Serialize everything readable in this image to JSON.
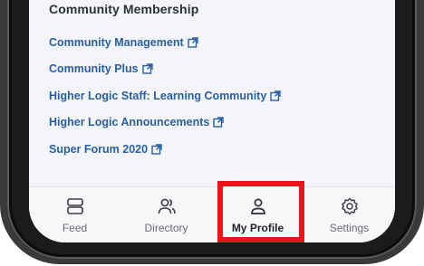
{
  "section": {
    "title": "Community Membership"
  },
  "links": [
    {
      "label": "Community Management",
      "icon": "external-link-icon"
    },
    {
      "label": "Community Plus",
      "icon": "external-link-icon"
    },
    {
      "label": "Higher Logic Staff: Learning Community",
      "icon": "external-link-icon"
    },
    {
      "label": "Higher Logic Announcements",
      "icon": "external-link-icon"
    },
    {
      "label": "Super Forum 2020",
      "icon": "external-link-icon"
    }
  ],
  "tabbar": {
    "tabs": [
      {
        "label": "Feed",
        "icon": "feed-icon"
      },
      {
        "label": "Directory",
        "icon": "directory-icon"
      },
      {
        "label": "My Profile",
        "icon": "profile-icon",
        "active": true
      },
      {
        "label": "Settings",
        "icon": "settings-icon"
      }
    ]
  },
  "colors": {
    "link": "#2a5f9e",
    "highlight": "#e4161b",
    "screen_bg": "#f4f5fa",
    "frame": "#1b1b1d"
  }
}
